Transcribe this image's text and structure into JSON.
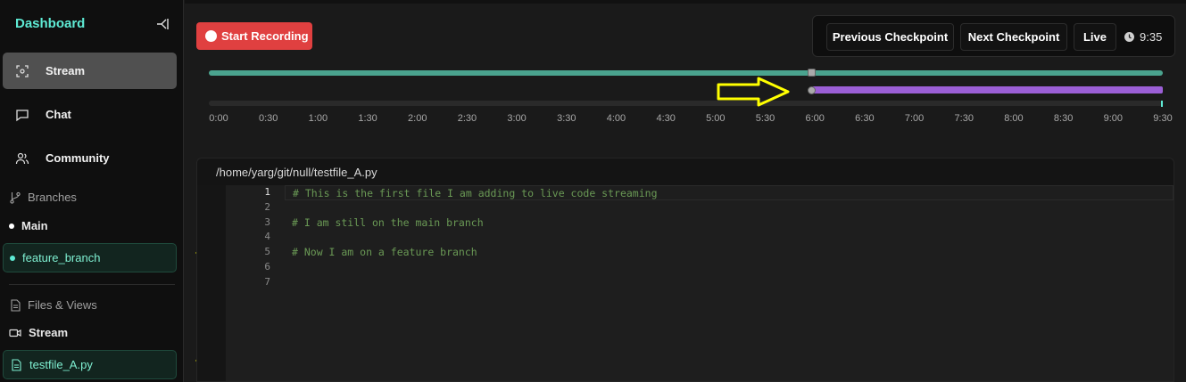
{
  "sidebar": {
    "title": "Dashboard",
    "nav": [
      {
        "label": "Stream",
        "icon": "scan-icon",
        "active": true
      },
      {
        "label": "Chat",
        "icon": "chat-icon",
        "active": false
      },
      {
        "label": "Community",
        "icon": "users-icon",
        "active": false
      }
    ],
    "branches_heading": "Branches",
    "branches": [
      {
        "label": "Main",
        "selected": false
      },
      {
        "label": "feature_branch",
        "selected": true
      }
    ],
    "files_heading": "Files & Views",
    "files": [
      {
        "label": "Stream",
        "icon": "video-icon",
        "selected": false
      },
      {
        "label": "testfile_A.py",
        "icon": "file-icon",
        "selected": true
      }
    ]
  },
  "toolbar": {
    "record_label": "Start Recording",
    "prev_checkpoint": "Previous Checkpoint",
    "next_checkpoint": "Next Checkpoint",
    "live": "Live",
    "time": "9:35"
  },
  "timeline": {
    "ticks": [
      "0:00",
      "0:30",
      "1:00",
      "1:30",
      "2:00",
      "2:30",
      "3:00",
      "3:30",
      "4:00",
      "4:30",
      "5:00",
      "5:30",
      "6:00",
      "6:30",
      "7:00",
      "7:30",
      "8:00",
      "8:30",
      "9:00",
      "9:30"
    ],
    "playhead_time": "6:00"
  },
  "editor": {
    "path": "/home/yarg/git/null/testfile_A.py",
    "lines": [
      "# This is the first file I am adding to live code streaming",
      "",
      "# I am still on the main branch",
      "",
      "# Now I am on a feature branch",
      "",
      ""
    ],
    "line_numbers": [
      "1",
      "2",
      "3",
      "4",
      "5",
      "6",
      "7"
    ]
  },
  "colors": {
    "accent": "#5eead4",
    "record": "#e04040",
    "track_green": "#4aa38e",
    "track_purple": "#9b5fd6",
    "annotation_arrow": "#ffff00"
  }
}
